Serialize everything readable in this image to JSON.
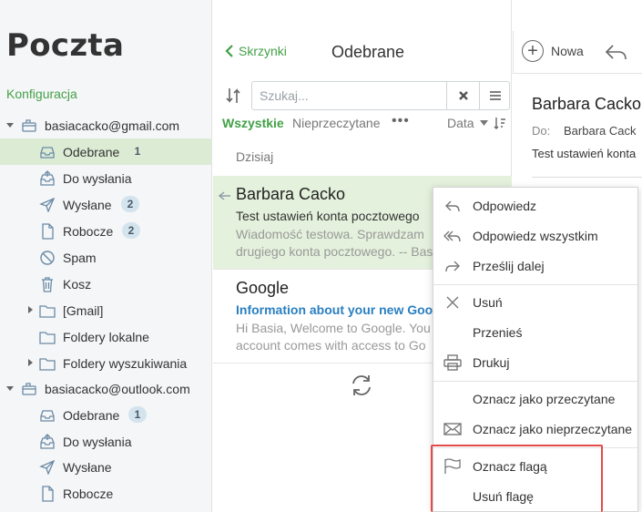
{
  "app": {
    "title": "Poczta",
    "config_link": "Konfiguracja"
  },
  "accounts": [
    {
      "email": "basiacacko@gmail.com",
      "folders": [
        {
          "label": "Odebrane",
          "count": "1",
          "icon": "inbox-icon",
          "selected": true
        },
        {
          "label": "Do wysłania",
          "count": "",
          "icon": "outbox-icon"
        },
        {
          "label": "Wysłane",
          "count": "2",
          "icon": "sent-icon"
        },
        {
          "label": "Robocze",
          "count": "2",
          "icon": "drafts-icon"
        },
        {
          "label": "Spam",
          "count": "",
          "icon": "spam-icon"
        },
        {
          "label": "Kosz",
          "count": "",
          "icon": "trash-icon"
        },
        {
          "label": "[Gmail]",
          "count": "",
          "icon": "folder-icon",
          "expandable": true
        },
        {
          "label": "Foldery lokalne",
          "count": "",
          "icon": "folder-icon"
        },
        {
          "label": "Foldery wyszukiwania",
          "count": "",
          "icon": "folder-icon",
          "expandable": true
        }
      ]
    },
    {
      "email": "basiacacko@outlook.com",
      "folders": [
        {
          "label": "Odebrane",
          "count": "1",
          "icon": "inbox-icon"
        },
        {
          "label": "Do wysłania",
          "count": "",
          "icon": "outbox-icon"
        },
        {
          "label": "Wysłane",
          "count": "",
          "icon": "sent-icon"
        },
        {
          "label": "Robocze",
          "count": "",
          "icon": "drafts-icon"
        }
      ]
    }
  ],
  "list": {
    "back_label": "Skrzynki",
    "folder_title": "Odebrane",
    "search_placeholder": "Szukaj...",
    "filter_all": "Wszystkie",
    "filter_unread": "Nieprzeczytane",
    "more": "•••",
    "sort_label": "Data",
    "section_today": "Dzisiaj",
    "messages": [
      {
        "sender": "Barbara Cacko",
        "subject": "Test ustawień konta pocztowego",
        "preview": "Wiadomość testowa. Sprawdzam\ndrugiego konta pocztowego. -- Bas"
      },
      {
        "sender": "Google",
        "subject": "Information about your new Googl",
        "preview": "Hi Basia, Welcome to Google. You\naccount comes with access to Go"
      }
    ]
  },
  "toolbar": {
    "new_label": "Nowa"
  },
  "reader": {
    "sender": "Barbara Cacko",
    "to_label": "Do:",
    "to": "Barbara Cack",
    "subject": "Test ustawień konta"
  },
  "context_menu": {
    "reply": "Odpowiedz",
    "reply_all": "Odpowiedz wszystkim",
    "forward": "Prześlij dalej",
    "delete": "Usuń",
    "move": "Przenieś",
    "print": "Drukuj",
    "mark_read": "Oznacz jako przeczytane",
    "mark_unread": "Oznacz jako nieprzeczytane",
    "flag": "Oznacz flagą",
    "unflag": "Usuń flagę"
  },
  "colors": {
    "accent": "#43a047",
    "selected_bg": "#dcecd4",
    "highlight": "#e34b4b",
    "link": "#2a7fc1"
  }
}
